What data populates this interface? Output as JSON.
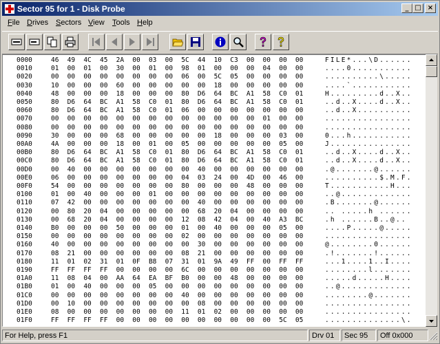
{
  "window": {
    "title": "Sector 95 for 1 - Disk Probe"
  },
  "title_buttons": {
    "minimize": "_",
    "maximize": "□",
    "close": "×"
  },
  "menu": [
    {
      "label": "File",
      "key": "F",
      "rest": "ile"
    },
    {
      "label": "Drives",
      "key": "D",
      "rest": "rives"
    },
    {
      "label": "Sectors",
      "key": "S",
      "rest": "ectors"
    },
    {
      "label": "View",
      "key": "V",
      "rest": "iew"
    },
    {
      "label": "Tools",
      "key": "T",
      "rest": "ools"
    },
    {
      "label": "Help",
      "key": "H",
      "rest": "elp"
    }
  ],
  "toolbar_icons": [
    "read-sector-icon",
    "write-sector-icon",
    "copy-icon",
    "print-icon",
    "first-sector-icon",
    "previous-sector-icon",
    "next-sector-icon",
    "last-sector-icon",
    "open-file-icon",
    "save-icon",
    "info-icon",
    "find-icon",
    "help-icon",
    "context-help-icon"
  ],
  "hex_rows": [
    {
      "off": "0000",
      "hex": "46 49 4C 45 2A 00 03 00 5C 44 10 C3 00 00 00 00",
      "asc": "FILE*...\\D......"
    },
    {
      "off": "0010",
      "hex": "01 00 01 00 30 00 01 00 98 01 00 00 00 04 00 00",
      "asc": "....0..........."
    },
    {
      "off": "0020",
      "hex": "00 00 00 00 00 00 00 00 06 00 5C 05 00 00 00 00",
      "asc": "..........\\....."
    },
    {
      "off": "0030",
      "hex": "10 00 00 00 60 00 00 00 00 00 18 00 00 00 00 00",
      "asc": "....`..........."
    },
    {
      "off": "0040",
      "hex": "48 00 00 00 18 00 00 00 80 D6 64 BC A1 58 C0 01",
      "asc": "H.........d..X.."
    },
    {
      "off": "0050",
      "hex": "80 D6 64 BC A1 58 C0 01 80 D6 64 BC A1 58 C0 01",
      "asc": "..d..X....d..X.."
    },
    {
      "off": "0060",
      "hex": "80 D6 64 BC A1 58 C0 01 06 00 00 00 00 00 00 00",
      "asc": "..d..X.........."
    },
    {
      "off": "0070",
      "hex": "00 00 00 00 00 00 00 00 00 00 00 00 00 01 00 00",
      "asc": "................"
    },
    {
      "off": "0080",
      "hex": "00 00 00 00 00 00 00 00 00 00 00 00 00 00 00 00",
      "asc": "................"
    },
    {
      "off": "0090",
      "hex": "30 00 00 00 68 00 00 00 00 00 18 00 00 00 03 00",
      "asc": "0...h..........."
    },
    {
      "off": "00A0",
      "hex": "4A 00 00 00 18 00 01 00 05 00 00 00 00 00 05 00",
      "asc": "J..............."
    },
    {
      "off": "00B0",
      "hex": "80 D6 64 BC A1 58 C0 01 80 D6 64 BC A1 58 C0 01",
      "asc": "..d..X....d..X.."
    },
    {
      "off": "00C0",
      "hex": "80 D6 64 BC A1 58 C0 01 80 D6 64 BC A1 58 C0 01",
      "asc": "..d..X....d..X.."
    },
    {
      "off": "00D0",
      "hex": "00 40 00 00 00 00 00 00 00 40 00 00 00 00 00 00",
      "asc": ".@.......@......"
    },
    {
      "off": "00E0",
      "hex": "06 00 00 00 00 00 00 00 04 03 24 00 4D 00 46 00",
      "asc": "..........$.M.F."
    },
    {
      "off": "00F0",
      "hex": "54 00 00 00 00 00 00 00 80 00 00 00 48 00 00 00",
      "asc": "T...........H..."
    },
    {
      "off": "0100",
      "hex": "01 00 40 00 00 00 01 00 00 00 00 00 00 00 00 00",
      "asc": "..@............."
    },
    {
      "off": "0110",
      "hex": "07 42 00 00 00 00 00 00 00 40 00 00 00 00 00 00",
      "asc": ".B.......@......"
    },
    {
      "off": "0120",
      "hex": "00 80 20 04 00 00 00 00 00 68 20 04 00 00 00 00",
      "asc": ".. .....h ......"
    },
    {
      "off": "0130",
      "hex": "00 68 20 04 00 00 00 00 12 08 42 04 00 40 A3 BC",
      "asc": ".h ......B..@.."
    },
    {
      "off": "0140",
      "hex": "B0 00 00 00 50 00 00 00 01 00 40 00 00 00 05 00",
      "asc": "....P.....@....."
    },
    {
      "off": "0150",
      "hex": "00 00 00 00 00 00 00 00 02 00 00 00 00 00 00 00",
      "asc": "................"
    },
    {
      "off": "0160",
      "hex": "40 00 00 00 00 00 00 00 00 30 00 00 00 00 00 00",
      "asc": "@........0......"
    },
    {
      "off": "0170",
      "hex": "08 21 00 00 00 00 00 00 08 21 00 00 00 00 00 00",
      "asc": ".!.......!......"
    },
    {
      "off": "0180",
      "hex": "11 01 02 31 01 0F B8 07 31 01 9A 49 FF 00 FF FF",
      "asc": "...1....1..I...."
    },
    {
      "off": "0190",
      "hex": "FF FF FF FF 00 00 00 00 6C 00 00 00 00 00 00 00",
      "asc": "........l......."
    },
    {
      "off": "01A0",
      "hex": "11 08 04 00 AA 64 EA BF B0 00 00 48 00 00 00 00",
      "asc": ".....d.....H...."
    },
    {
      "off": "01B0",
      "hex": "01 00 40 00 00 00 05 00 00 00 00 00 00 00 00 00",
      "asc": "..@............."
    },
    {
      "off": "01C0",
      "hex": "00 00 00 00 00 00 00 00 40 00 00 00 00 00 00 00",
      "asc": "........@......."
    },
    {
      "off": "01D0",
      "hex": "00 10 00 00 00 00 00 00 00 08 00 00 00 00 00 00",
      "asc": "................"
    },
    {
      "off": "01E0",
      "hex": "08 00 00 00 00 00 00 00 11 01 02 00 00 00 00 00",
      "asc": "................"
    },
    {
      "off": "01F0",
      "hex": "FF FF FF FF 00 00 00 00 00 00 00 00 00 00 5C 05",
      "asc": "..............\\."
    }
  ],
  "status": {
    "help": "For Help, press F1",
    "drive": "Drv  01",
    "sector": "Sec 95",
    "offset": "Off 0x000"
  }
}
